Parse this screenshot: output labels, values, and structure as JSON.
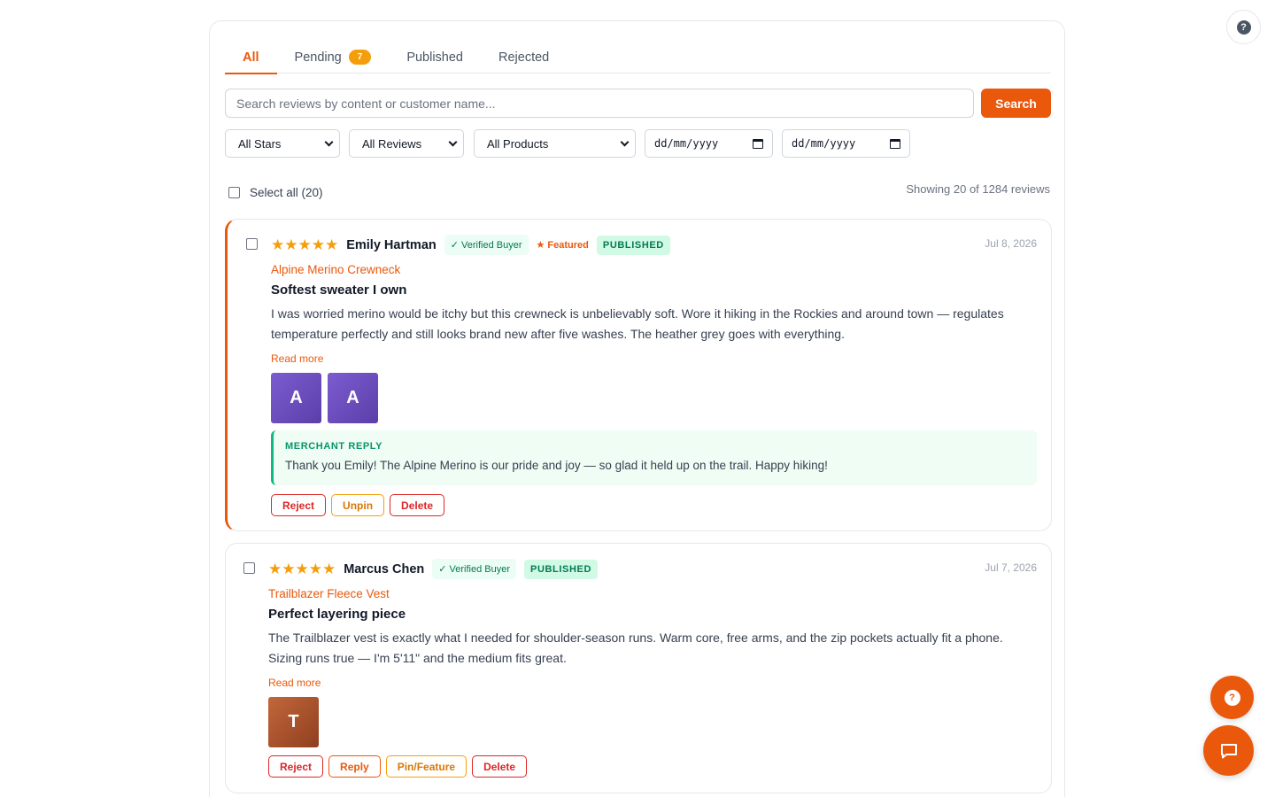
{
  "tabs": [
    {
      "label": "All",
      "active": true
    },
    {
      "label": "Pending",
      "badge": "7"
    },
    {
      "label": "Published"
    },
    {
      "label": "Rejected"
    }
  ],
  "search": {
    "placeholder": "Search reviews by content or customer name...",
    "value": "",
    "button_label": "Search"
  },
  "filters": {
    "stars": "All Stars",
    "reviews": "All Reviews",
    "products": "All Products",
    "date_from": "dd/mm/yyyy",
    "date_to": "dd/mm/yyyy"
  },
  "select_all_label": "Select all (20)",
  "showing_text": "Showing 20 of 1284 reviews",
  "reviews": [
    {
      "stars": "★★★★★",
      "rating": 5,
      "name": "Emily Hartman",
      "verified": "✓ Verified Buyer",
      "featured": "★ Featured",
      "status": "PUBLISHED",
      "date": "Jul 8, 2026",
      "product": "Alpine Merino Crewneck",
      "title": "Softest sweater I own",
      "body": "I was worried merino would be itchy but this crewneck is unbelievably soft. Wore it hiking in the Rockies and around town — regulates temperature perfectly and still looks brand new after five washes. The heather grey goes with everything.",
      "read_more": "Read more",
      "photos": [
        "A",
        "A"
      ],
      "reply_label": "MERCHANT REPLY",
      "reply_text": "Thank you Emily! The Alpine Merino is our pride and joy — so glad it held up on the trail. Happy hiking!",
      "actions": [
        "Reject",
        "Unpin",
        "Delete"
      ]
    },
    {
      "stars": "★★★★★",
      "rating": 5,
      "name": "Marcus Chen",
      "verified": "✓ Verified Buyer",
      "status": "PUBLISHED",
      "date": "Jul 7, 2026",
      "product": "Trailblazer Fleece Vest",
      "title": "Perfect layering piece",
      "body": "The Trailblazer vest is exactly what I needed for shoulder-season runs. Warm core, free arms, and the zip pockets actually fit a phone. Sizing runs true — I'm 5'11\" and the medium fits great.",
      "read_more": "Read more",
      "photos": [
        "T"
      ],
      "actions": [
        "Reject",
        "Reply",
        "Pin/Feature",
        "Delete"
      ]
    }
  ],
  "help_symbol": "?",
  "colors": {
    "accent": "#ea580c",
    "star": "#f59e0b",
    "success": "#047857",
    "danger": "#dc2626"
  }
}
